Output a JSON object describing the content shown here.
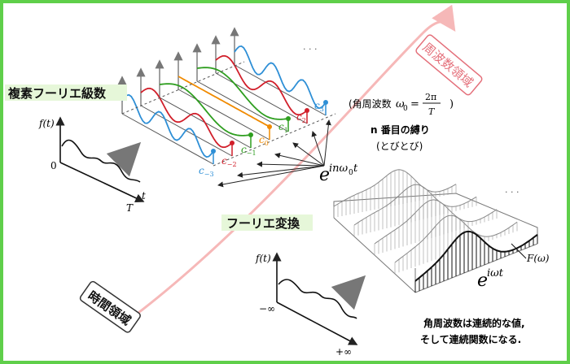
{
  "title_series": "複素フーリエ級数",
  "title_transform": "フーリエ変換",
  "label_time_domain": "時間領域",
  "label_freq_domain": "周波数領域",
  "note_angular": "(角周波数",
  "note_omega_lhs": "ω",
  "note_omega_sub": "0",
  "note_eq": "=",
  "note_frac_num": "2π",
  "note_frac_den": "T",
  "note_close": ")",
  "note_nth_1": "n 番目の縛り",
  "note_nth_2": "(とびとび)",
  "exp_series_base": "e",
  "exp_series_pow": "inω",
  "exp_series_sub": "0",
  "exp_series_t": "t",
  "exp_transform_base": "e",
  "exp_transform_pow": "iωt",
  "label_F": "F(ω)",
  "label_ft1": "f(t)",
  "label_ft2": "f(t)",
  "label_zero": "0",
  "label_t": "t",
  "label_T": "T",
  "label_minus_inf": "−∞",
  "label_plus_inf": "+∞",
  "coef_labels": [
    {
      "text": "c",
      "sub": "−3"
    },
    {
      "text": "c",
      "sub": "−2"
    },
    {
      "text": "c",
      "sub": "−1"
    },
    {
      "text": "c",
      "sub": "0"
    },
    {
      "text": "c",
      "sub": "1"
    },
    {
      "text": "c",
      "sub": "2"
    },
    {
      "text": "c",
      "sub": "3"
    }
  ],
  "conclusion_1": "角周波数は連続的な値,",
  "conclusion_2": "そして連続関数になる.",
  "dots": "· · ·",
  "colors": {
    "border": "#5fcf4a",
    "highlight": "#e6f7d9",
    "blue": "#2e8fd6",
    "red": "#d11f2a",
    "green": "#2e9e1f",
    "orange": "#f08a00",
    "arc": "#f6b8b8",
    "freq_text": "#e46f7a",
    "arrow_grey": "#777777"
  }
}
